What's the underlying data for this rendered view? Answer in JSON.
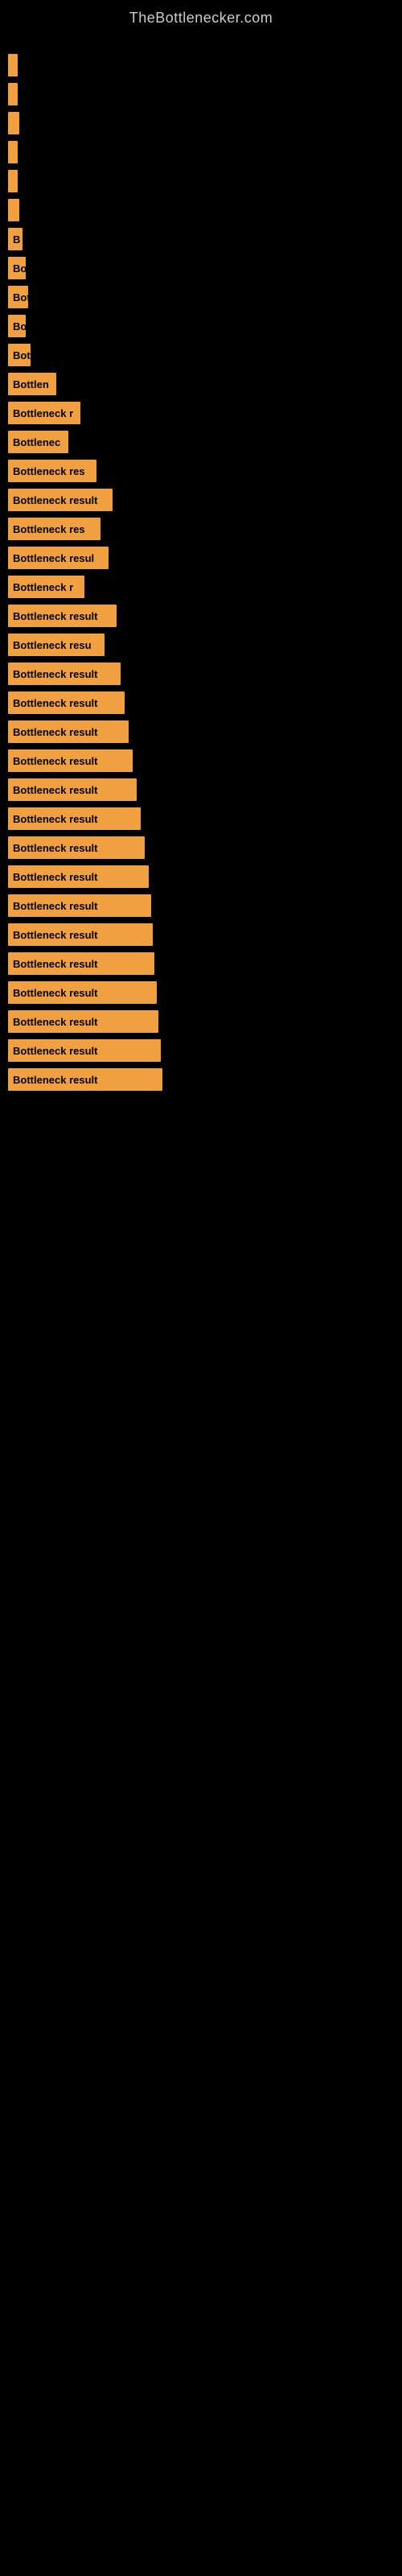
{
  "site": {
    "title": "TheBottlenecker.com"
  },
  "bars": [
    {
      "id": 1,
      "label": "",
      "width": 12,
      "visible_text": ""
    },
    {
      "id": 2,
      "label": "",
      "width": 12,
      "visible_text": ""
    },
    {
      "id": 3,
      "label": "",
      "width": 14,
      "visible_text": ""
    },
    {
      "id": 4,
      "label": "",
      "width": 12,
      "visible_text": ""
    },
    {
      "id": 5,
      "label": "",
      "width": 12,
      "visible_text": ""
    },
    {
      "id": 6,
      "label": "",
      "width": 14,
      "visible_text": ""
    },
    {
      "id": 7,
      "label": "B",
      "width": 18,
      "visible_text": "B"
    },
    {
      "id": 8,
      "label": "Bo",
      "width": 22,
      "visible_text": "Bo"
    },
    {
      "id": 9,
      "label": "Bot",
      "width": 25,
      "visible_text": "Bot"
    },
    {
      "id": 10,
      "label": "Bo",
      "width": 22,
      "visible_text": "Bo"
    },
    {
      "id": 11,
      "label": "Bot",
      "width": 28,
      "visible_text": "Bot"
    },
    {
      "id": 12,
      "label": "Bottlen",
      "width": 60,
      "visible_text": "Bottlen"
    },
    {
      "id": 13,
      "label": "Bottleneck r",
      "width": 90,
      "visible_text": "Bottleneck r"
    },
    {
      "id": 14,
      "label": "Bottlenec",
      "width": 75,
      "visible_text": "Bottlenec"
    },
    {
      "id": 15,
      "label": "Bottleneck res",
      "width": 110,
      "visible_text": "Bottleneck res"
    },
    {
      "id": 16,
      "label": "Bottleneck result",
      "width": 130,
      "visible_text": "Bottleneck result"
    },
    {
      "id": 17,
      "label": "Bottleneck res",
      "width": 115,
      "visible_text": "Bottleneck res"
    },
    {
      "id": 18,
      "label": "Bottleneck resul",
      "width": 125,
      "visible_text": "Bottleneck resul"
    },
    {
      "id": 19,
      "label": "Bottleneck r",
      "width": 95,
      "visible_text": "Bottleneck r"
    },
    {
      "id": 20,
      "label": "Bottleneck result",
      "width": 135,
      "visible_text": "Bottleneck result"
    },
    {
      "id": 21,
      "label": "Bottleneck resu",
      "width": 120,
      "visible_text": "Bottleneck resu"
    },
    {
      "id": 22,
      "label": "Bottleneck result",
      "width": 140,
      "visible_text": "Bottleneck result"
    },
    {
      "id": 23,
      "label": "Bottleneck result",
      "width": 145,
      "visible_text": "Bottleneck result"
    },
    {
      "id": 24,
      "label": "Bottleneck result",
      "width": 150,
      "visible_text": "Bottleneck result"
    },
    {
      "id": 25,
      "label": "Bottleneck result",
      "width": 155,
      "visible_text": "Bottleneck result"
    },
    {
      "id": 26,
      "label": "Bottleneck result",
      "width": 160,
      "visible_text": "Bottleneck result"
    },
    {
      "id": 27,
      "label": "Bottleneck result",
      "width": 165,
      "visible_text": "Bottleneck result"
    },
    {
      "id": 28,
      "label": "Bottleneck result",
      "width": 170,
      "visible_text": "Bottleneck result"
    },
    {
      "id": 29,
      "label": "Bottleneck result",
      "width": 175,
      "visible_text": "Bottleneck result"
    },
    {
      "id": 30,
      "label": "Bottleneck result",
      "width": 178,
      "visible_text": "Bottleneck result"
    },
    {
      "id": 31,
      "label": "Bottleneck result",
      "width": 180,
      "visible_text": "Bottleneck result"
    },
    {
      "id": 32,
      "label": "Bottleneck result",
      "width": 182,
      "visible_text": "Bottleneck result"
    },
    {
      "id": 33,
      "label": "Bottleneck result",
      "width": 185,
      "visible_text": "Bottleneck result"
    },
    {
      "id": 34,
      "label": "Bottleneck result",
      "width": 187,
      "visible_text": "Bottleneck result"
    },
    {
      "id": 35,
      "label": "Bottleneck result",
      "width": 190,
      "visible_text": "Bottleneck result"
    },
    {
      "id": 36,
      "label": "Bottleneck result",
      "width": 192,
      "visible_text": "Bottleneck result"
    }
  ]
}
